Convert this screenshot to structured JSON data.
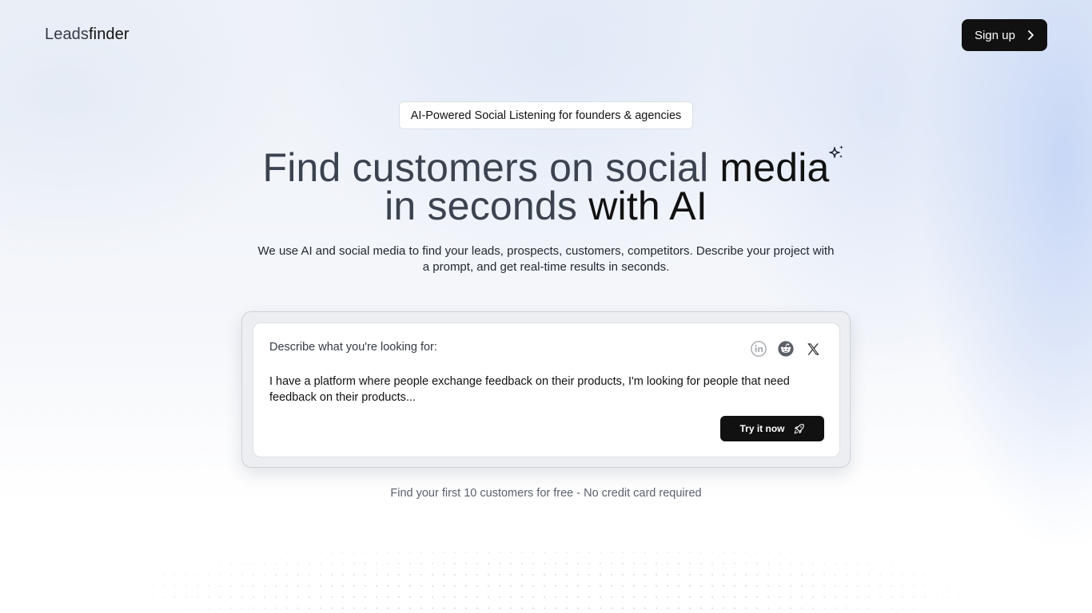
{
  "header": {
    "logo_part1": "Leads",
    "logo_part2": "finder",
    "signup_label": "Sign up"
  },
  "hero": {
    "badge": "AI-Powered Social Listening for founders & agencies",
    "headline_line1_a": "Find customers on social ",
    "headline_line1_b": "media",
    "headline_line2_a": "in seconds ",
    "headline_line2_b": "with AI",
    "subtitle": "We use AI and social media to find your leads, prospects, customers, competitors. Describe your project with a prompt, and get real-time results in seconds."
  },
  "prompt_card": {
    "label": "Describe what you're looking for:",
    "text": "I have a platform where people exchange feedback on their products, I'm looking for people that need feedback on their products...",
    "button_label": "Try it now",
    "platforms": [
      "linkedin-icon",
      "reddit-icon",
      "x-icon"
    ]
  },
  "footnote": "Find your first 10 customers for free - No credit card required",
  "colors": {
    "primary": "#111111",
    "muted_text": "#3c4350",
    "background": "#eef2f8"
  }
}
